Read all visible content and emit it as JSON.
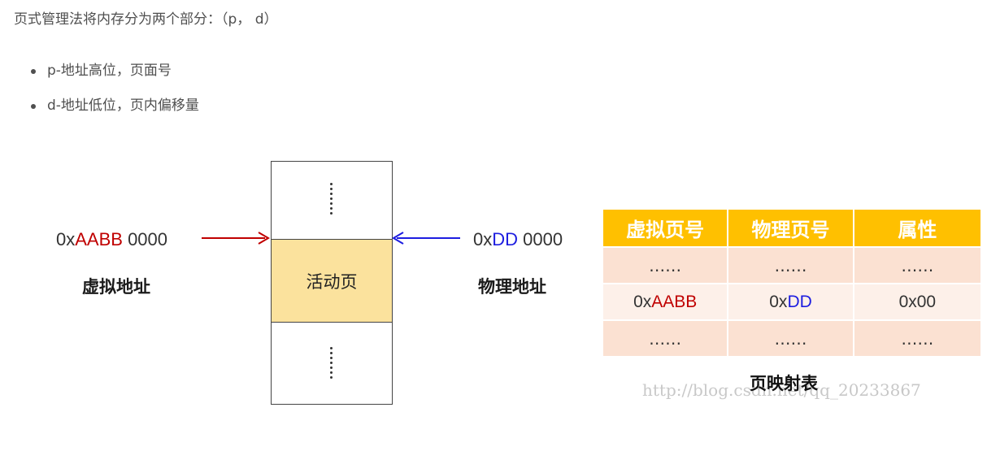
{
  "intro": "页式管理法将内存分为两个部分：（p， d）",
  "bullets": [
    {
      "text": "p-地址高位，页面号"
    },
    {
      "text": "d-地址低位，页内偏移量"
    }
  ],
  "diagram": {
    "virtual_address": {
      "prefix": "0x",
      "highlight": "AABB",
      "suffix": " 0000",
      "caption": "虚拟地址"
    },
    "physical_address": {
      "prefix": "0x",
      "highlight": "DD",
      "suffix": " 0000",
      "caption": "物理地址"
    },
    "memory": {
      "active_label": "活动页"
    },
    "colors": {
      "virtual": "#c00000",
      "physical": "#1d1de0",
      "active_page": "#fbe29d",
      "table_header": "#ffc000"
    },
    "table": {
      "headers": [
        "虚拟页号",
        "物理页号",
        "属性"
      ],
      "rows": [
        [
          "……",
          "……",
          "……"
        ],
        [
          "AABB",
          "DD",
          "0x00"
        ],
        [
          "……",
          "……",
          "……"
        ]
      ],
      "row2_prefix": "0x",
      "caption": "页映射表"
    },
    "watermark": "http://blog.csdn.net/qq_20233867"
  }
}
